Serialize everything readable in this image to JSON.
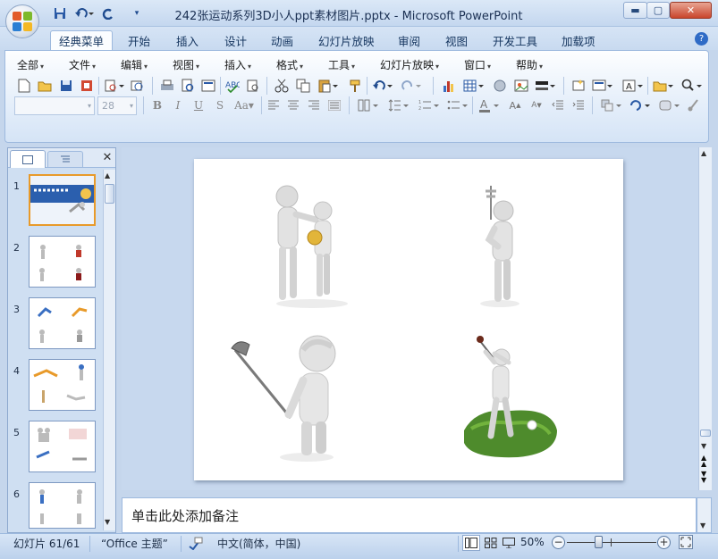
{
  "window": {
    "title": "242张运动系列3D小人ppt素材图片.pptx - Microsoft PowerPoint",
    "controls": [
      "minimize-icon",
      "maximize-icon",
      "close-icon"
    ]
  },
  "quick_access": [
    "save-icon",
    "undo-icon",
    "redo-icon",
    "customize-icon"
  ],
  "tabs": [
    "经典菜单",
    "开始",
    "插入",
    "设计",
    "动画",
    "幻灯片放映",
    "审阅",
    "视图",
    "开发工具",
    "加载项"
  ],
  "active_tab": "经典菜单",
  "menus": [
    "全部",
    "文件",
    "编辑",
    "视图",
    "插入",
    "格式",
    "工具",
    "幻灯片放映",
    "窗口",
    "帮助"
  ],
  "format_bar": {
    "font_name": "",
    "font_size": "28"
  },
  "slides_panel": {
    "slides": [
      {
        "number": "1"
      },
      {
        "number": "2"
      },
      {
        "number": "3"
      },
      {
        "number": "4"
      },
      {
        "number": "5"
      },
      {
        "number": "6"
      }
    ],
    "selected": "1"
  },
  "notes": {
    "placeholder": "单击此处添加备注"
  },
  "status": {
    "slide_info": "幻灯片 61/61",
    "theme": "“Office 主题”",
    "language": "中文(简体，中国)",
    "zoom": "50%",
    "zoom_fraction": 0.5
  },
  "colors": {
    "ribbon_blue": "#c4d7ef",
    "accent_blue": "#1f4b8f",
    "grass_green": "#4e8b2c"
  }
}
